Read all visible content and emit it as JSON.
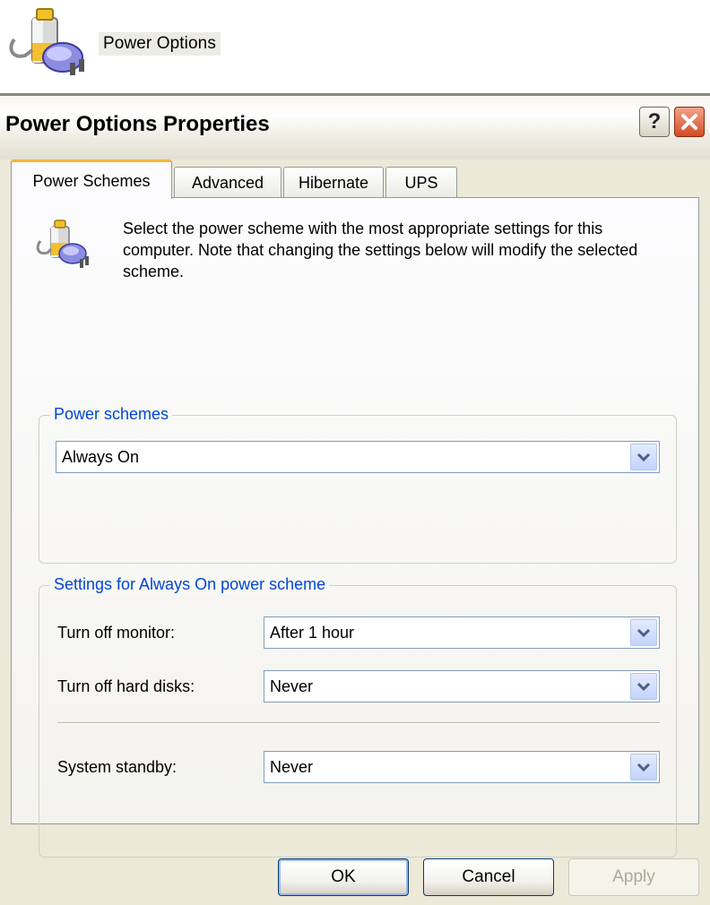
{
  "desktop_shortcut": {
    "label": "Power Options"
  },
  "window": {
    "title": "Power Options Properties",
    "help_label": "?",
    "tabs": [
      {
        "label": "Power Schemes",
        "active": true
      },
      {
        "label": "Advanced",
        "active": false
      },
      {
        "label": "Hibernate",
        "active": false
      },
      {
        "label": "UPS",
        "active": false
      }
    ],
    "intro_text": "Select the power scheme with the most appropriate settings for this computer. Note that changing the settings below will modify the selected scheme.",
    "power_schemes": {
      "legend": "Power schemes",
      "selected": "Always On"
    },
    "settings": {
      "legend": "Settings for Always On power scheme",
      "monitor_label": "Turn off monitor:",
      "monitor_value": "After 1 hour",
      "disks_label": "Turn off hard disks:",
      "disks_value": "Never",
      "standby_label": "System standby:",
      "standby_value": "Never"
    },
    "buttons": {
      "ok": "OK",
      "cancel": "Cancel",
      "apply": "Apply"
    }
  },
  "colors": {
    "accent": "#0046d5",
    "active_tab_top": "#f6b43e",
    "close_button": "#d24b24"
  },
  "icons": [
    "power-options-icon",
    "help-icon",
    "close-icon",
    "dropdown-arrow-icon"
  ]
}
